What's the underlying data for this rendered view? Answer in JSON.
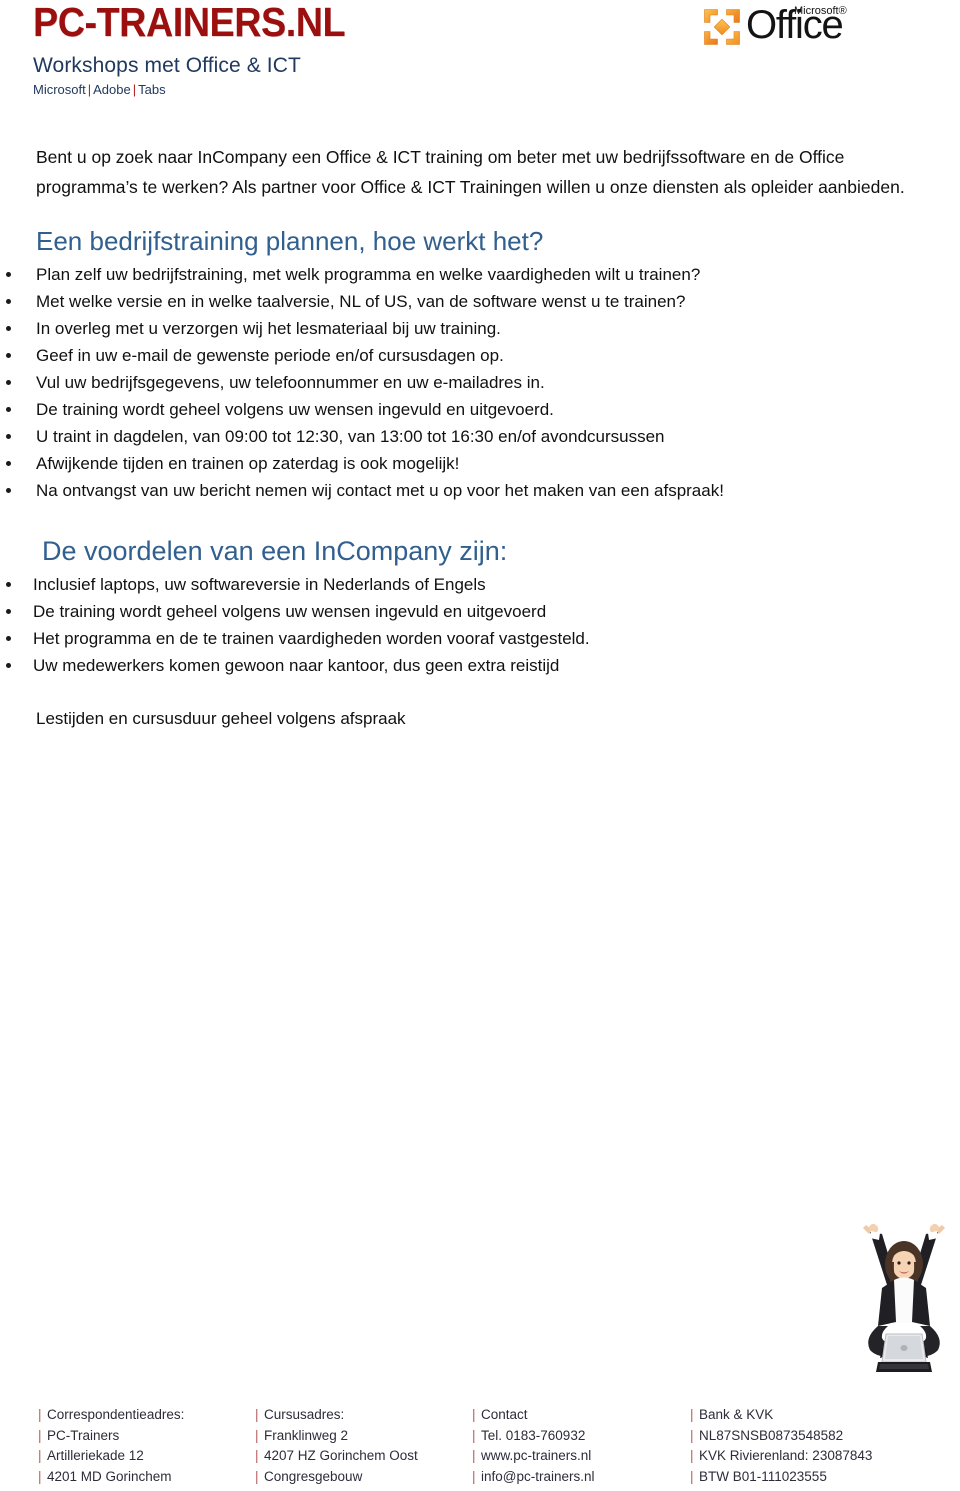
{
  "header": {
    "logo_text": "PC-TRAINERS.NL",
    "tagline": "Workshops met Office & ICT",
    "subtags": [
      "Microsoft",
      "Adobe",
      "Tabs"
    ],
    "office_logo": {
      "word": "Office",
      "superscript": "Microsoft®",
      "icon": "office-pinwheel-icon"
    },
    "colors": {
      "logo_red": "#9C0F0F",
      "tagline_navy": "#21395F",
      "separator_red": "#B42121"
    }
  },
  "main": {
    "intro": "Bent u op zoek naar InCompany een Office & ICT training om beter met uw bedrijfssoftware en de Office programma’s te werken? Als partner voor Office & ICT Trainingen willen u onze diensten als opleider aanbieden.",
    "heading_1": "Een bedrijfstraining plannen, hoe werkt het?",
    "list_1": [
      "Plan zelf uw bedrijfstraining, met welk programma en welke vaardigheden wilt u trainen?",
      "Met welke versie en in welke taalversie, NL of US, van de software wenst u te trainen?",
      "In overleg met u verzorgen wij het lesmateriaal bij uw training.",
      "Geef in uw e-mail de gewenste periode en/of cursusdagen op.",
      "Vul uw bedrijfsgegevens, uw telefoonnummer en uw e-mailadres in.",
      "De training wordt geheel volgens uw wensen ingevuld en uitgevoerd.",
      "U traint in dagdelen, van 09:00 tot 12:30, van 13:00 tot 16:30 en/of avondcursussen",
      "Afwijkende tijden en trainen op zaterdag is ook mogelijk!",
      "Na ontvangst van uw bericht nemen wij contact met u op voor het maken van een afspraak!"
    ],
    "heading_2": "De voordelen van een InCompany zijn:",
    "list_2": [
      "Inclusief laptops, uw softwareversie in Nederlands of Engels",
      "De training wordt geheel volgens uw wensen ingevuld en uitgevoerd",
      "Het programma en de te trainen vaardigheden worden vooraf vastgesteld.",
      "Uw medewerkers komen gewoon naar kantoor, dus geen extra reistijd"
    ],
    "closing_note": "Lestijden en cursusduur geheel volgens afspraak",
    "heading_color": "#31608F"
  },
  "photo": {
    "alt": "woman-cheering-with-laptop-photo"
  },
  "footer": {
    "columns": [
      {
        "name": "correspondence-address",
        "rows": [
          "Correspondentieadres:",
          "PC-Trainers",
          "Artilleriekade 12",
          "4201 MD Gorinchem"
        ]
      },
      {
        "name": "course-address",
        "rows": [
          "Cursusadres:",
          "Franklinweg 2",
          "4207 HZ  Gorinchem Oost",
          "Congresgebouw"
        ]
      },
      {
        "name": "contact",
        "rows": [
          "Contact",
          "Tel. 0183-760932",
          "www.pc-trainers.nl",
          "info@pc-trainers.nl"
        ]
      },
      {
        "name": "bank-kvk",
        "rows": [
          "Bank & KVK",
          "NL87SNSB0873548582",
          "KVK Rivierenland: 23087843",
          "BTW B01-111023555"
        ]
      }
    ],
    "separator_color": "#B5625F"
  }
}
